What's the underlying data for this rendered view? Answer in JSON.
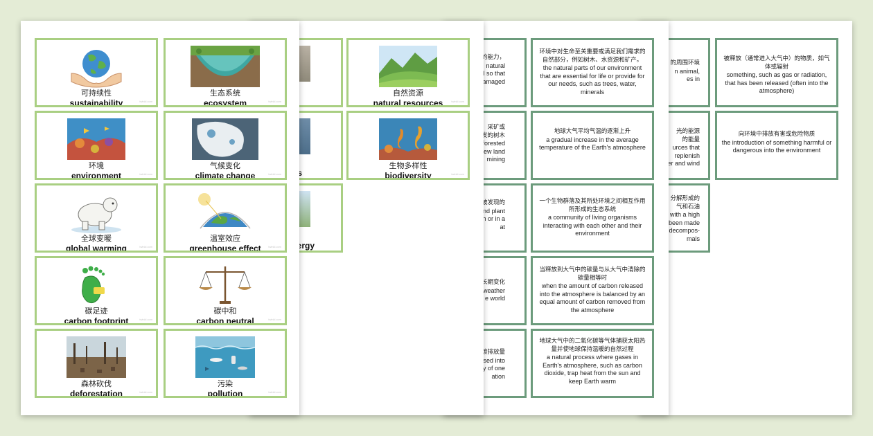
{
  "sheet1": {
    "cards": [
      {
        "cn": "可持续性",
        "en": "sustainability",
        "icon": "hands-globe-icon"
      },
      {
        "cn": "生态系统",
        "en": "ecosystem",
        "icon": "ecosystem-icon"
      },
      {
        "cn": "环境",
        "en": "environment",
        "icon": "coral-reef-icon"
      },
      {
        "cn": "气候变化",
        "en": "climate change",
        "icon": "melting-ice-icon"
      },
      {
        "cn": "全球变暖",
        "en": "global warming",
        "icon": "polar-bear-icon"
      },
      {
        "cn": "温室效应",
        "en": "greenhouse effect",
        "icon": "greenhouse-earth-icon"
      },
      {
        "cn": "碳足迹",
        "en": "carbon footprint",
        "icon": "co2-footprint-icon"
      },
      {
        "cn": "碳中和",
        "en": "carbon neutral",
        "icon": "balance-scale-icon"
      },
      {
        "cn": "森林砍伐",
        "en": "deforestation",
        "icon": "deforestation-icon"
      },
      {
        "cn": "污染",
        "en": "pollution",
        "icon": "ocean-pollution-icon"
      }
    ]
  },
  "sheet2": {
    "cards": [
      {
        "cn": "自然资源",
        "en": "natural resources",
        "icon": "green-hills-icon"
      },
      {
        "cn": "生物多样性",
        "en": "biodiversity",
        "icon": "seahorse-reef-icon"
      }
    ],
    "fragments": [
      "s",
      "ergy"
    ]
  },
  "sheet3": {
    "left_fragments": [
      [
        "手的能力，",
        "natural",
        "vel so that",
        "damaged"
      ],
      [
        "业、采矿或",
        "发的树木",
        "n forested",
        "new land",
        "mining"
      ],
      [
        "被发现的",
        "nd plant",
        "th or in a",
        "at"
      ],
      [
        "长期变化",
        "e weather",
        "e world"
      ],
      [
        "的碳排放量",
        "eased into",
        "tivity of one",
        "ation"
      ]
    ],
    "definitions": [
      {
        "cn": "环境中对生命至关重要或满足我们需求的自然部分，例如树木、水资源和矿产。",
        "en": "the natural parts of our environment that are essential for life or provide for our needs, such as trees, water, minerals"
      },
      {
        "cn": "地球大气平均气温的逐渐上升",
        "en": "a gradual increase in the average temperature of the Earth's atmosphere"
      },
      {
        "cn": "一个生物群落及其所处环境之间相互作用所形成的生态系统",
        "en": "a community of living organisms interacting with each other and their environment"
      },
      {
        "cn": "当释放到大气中的碳量与从大气中清除的碳量相等时",
        "en": "when the amount of carbon released into the atmosphere is balanced by an equal amount of carbon removed from the atmosphere"
      },
      {
        "cn": "地球大气中的二氧化碳等气体捕获太阳热量并使地球保持温暖的自然过程",
        "en": "a natural process where gases in Earth's atmosphere, such as carbon dioxide, trap heat from the sun and keep Earth warm"
      }
    ]
  },
  "sheet4": {
    "left_fragments": [
      [
        "的周围环境",
        "n animal,",
        "es in"
      ],
      [
        "光的能源",
        "的能量",
        "urces that",
        "replenish",
        "er and wind"
      ],
      [
        "分解形成的",
        "气和石油",
        "with a high",
        "been made",
        "decompos-",
        "mals"
      ]
    ],
    "definitions": [
      {
        "cn": "被释放（通常进入大气中）的物质，如气体或辐射",
        "en": "something, such as gas or radiation, that has been released (often into the atmosphere)"
      },
      {
        "cn": "向环境中排放有害或危险物质",
        "en": "the introduction of something harmful or dangerous into the environment"
      }
    ]
  },
  "watermark": "twinkl.com"
}
